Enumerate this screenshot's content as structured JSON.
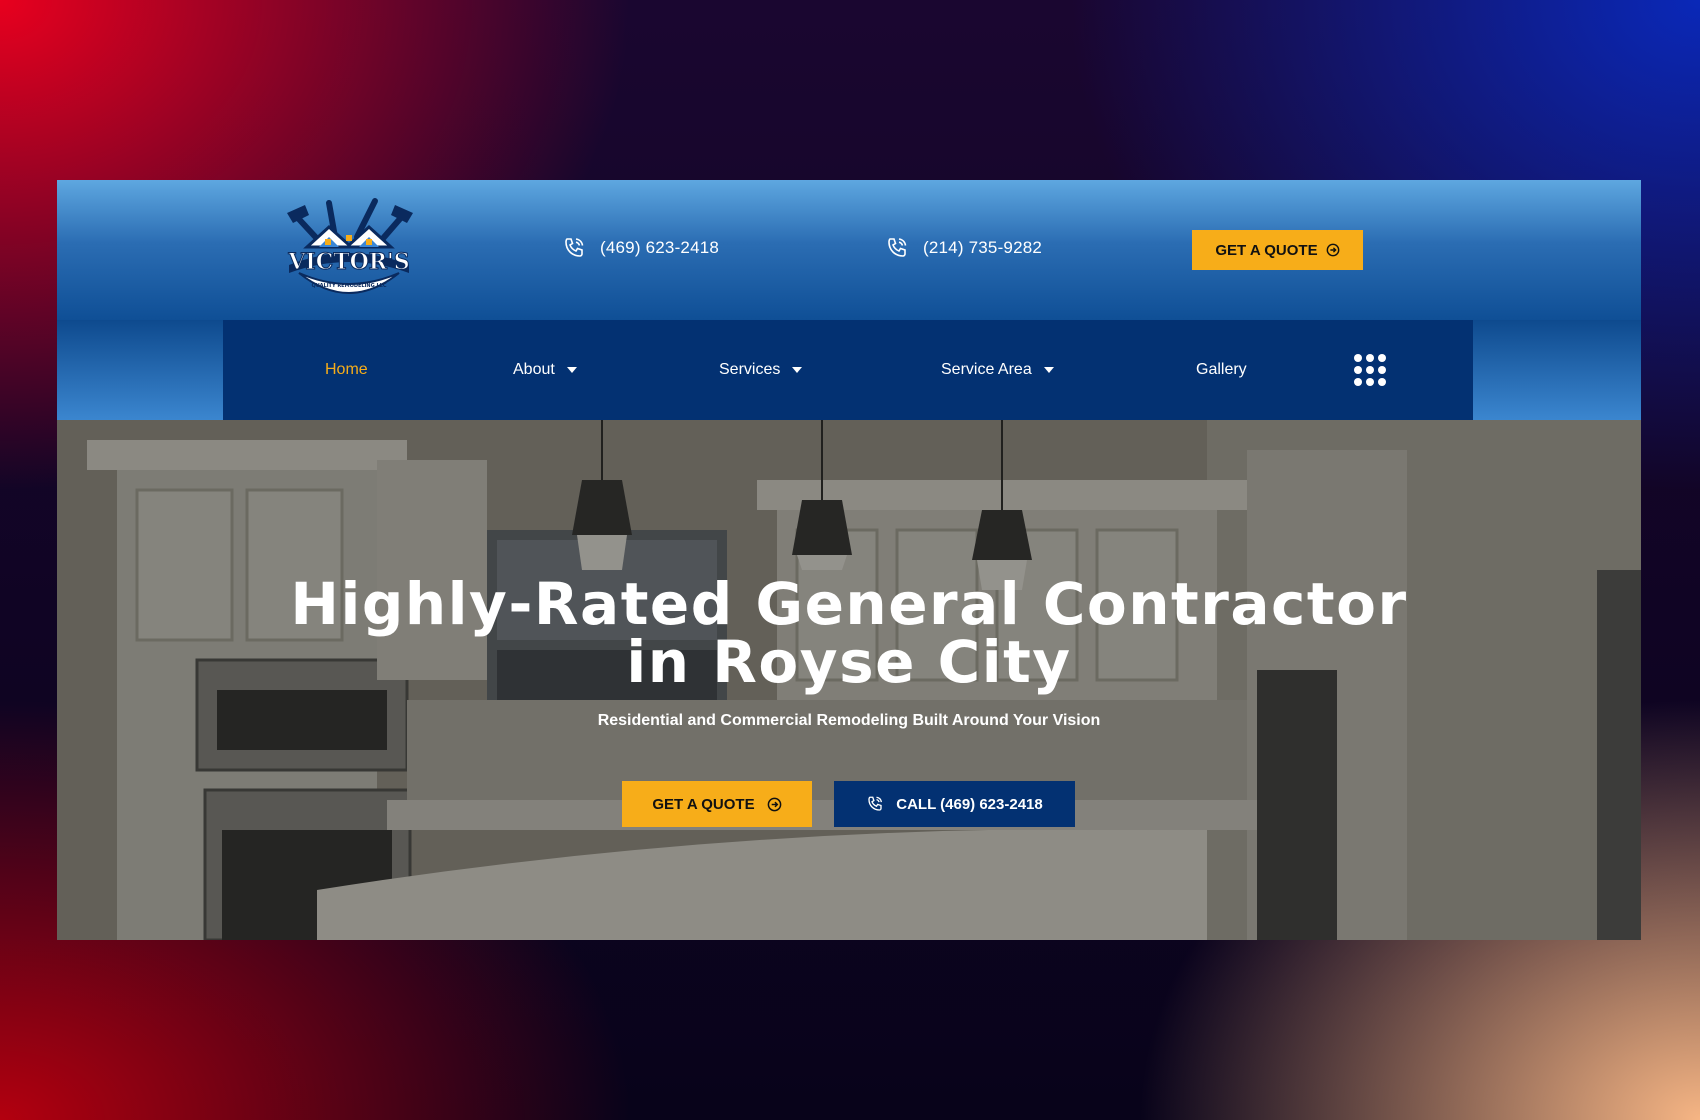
{
  "colors": {
    "accent": "#f7ad19",
    "navy": "#033172",
    "header_blue": "#2b6db3"
  },
  "header": {
    "logo_text": "VICTOR'S",
    "logo_subtext": "QUALITY REMODELING LLC",
    "phone_1": "(469) 623-2418",
    "phone_2": "(214) 735-9282",
    "quote_label": "GET A QUOTE"
  },
  "nav": {
    "items": [
      {
        "label": "Home",
        "active": true,
        "dropdown": false
      },
      {
        "label": "About",
        "active": false,
        "dropdown": true
      },
      {
        "label": "Services",
        "active": false,
        "dropdown": true
      },
      {
        "label": "Service Area",
        "active": false,
        "dropdown": true
      },
      {
        "label": "Gallery",
        "active": false,
        "dropdown": false
      }
    ],
    "menu_icon": "grid-dots-icon"
  },
  "hero": {
    "title_line1": "Highly-Rated General Contractor",
    "title_line2": "in Royse City",
    "subtitle": "Residential and Commercial Remodeling Built Around Your Vision",
    "quote_button": "GET A QUOTE",
    "call_button": "CALL (469) 623-2418"
  }
}
